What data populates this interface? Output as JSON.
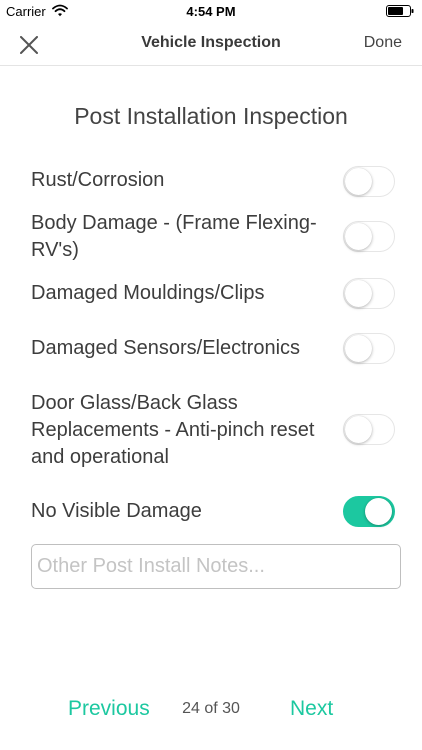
{
  "status_bar": {
    "carrier": "Carrier",
    "time": "4:54 PM"
  },
  "nav": {
    "title": "Vehicle Inspection",
    "done_label": "Done"
  },
  "page_title": "Post Installation Inspection",
  "items": [
    {
      "label": "Rust/Corrosion",
      "checked": false
    },
    {
      "label": "Body Damage - (Frame Flexing- RV's)",
      "checked": false
    },
    {
      "label": "Damaged Mouldings/Clips",
      "checked": false
    },
    {
      "label": "Damaged Sensors/Electronics",
      "checked": false
    },
    {
      "label": "Door Glass/Back Glass Replacements - Anti-pinch reset and operational",
      "checked": false
    },
    {
      "label": "No Visible Damage",
      "checked": true
    }
  ],
  "notes": {
    "placeholder": "Other Post Install Notes...",
    "value": ""
  },
  "footer": {
    "previous_label": "Previous",
    "page_indicator": "24 of 30",
    "next_label": "Next"
  },
  "colors": {
    "accent": "#1cc8a0"
  }
}
